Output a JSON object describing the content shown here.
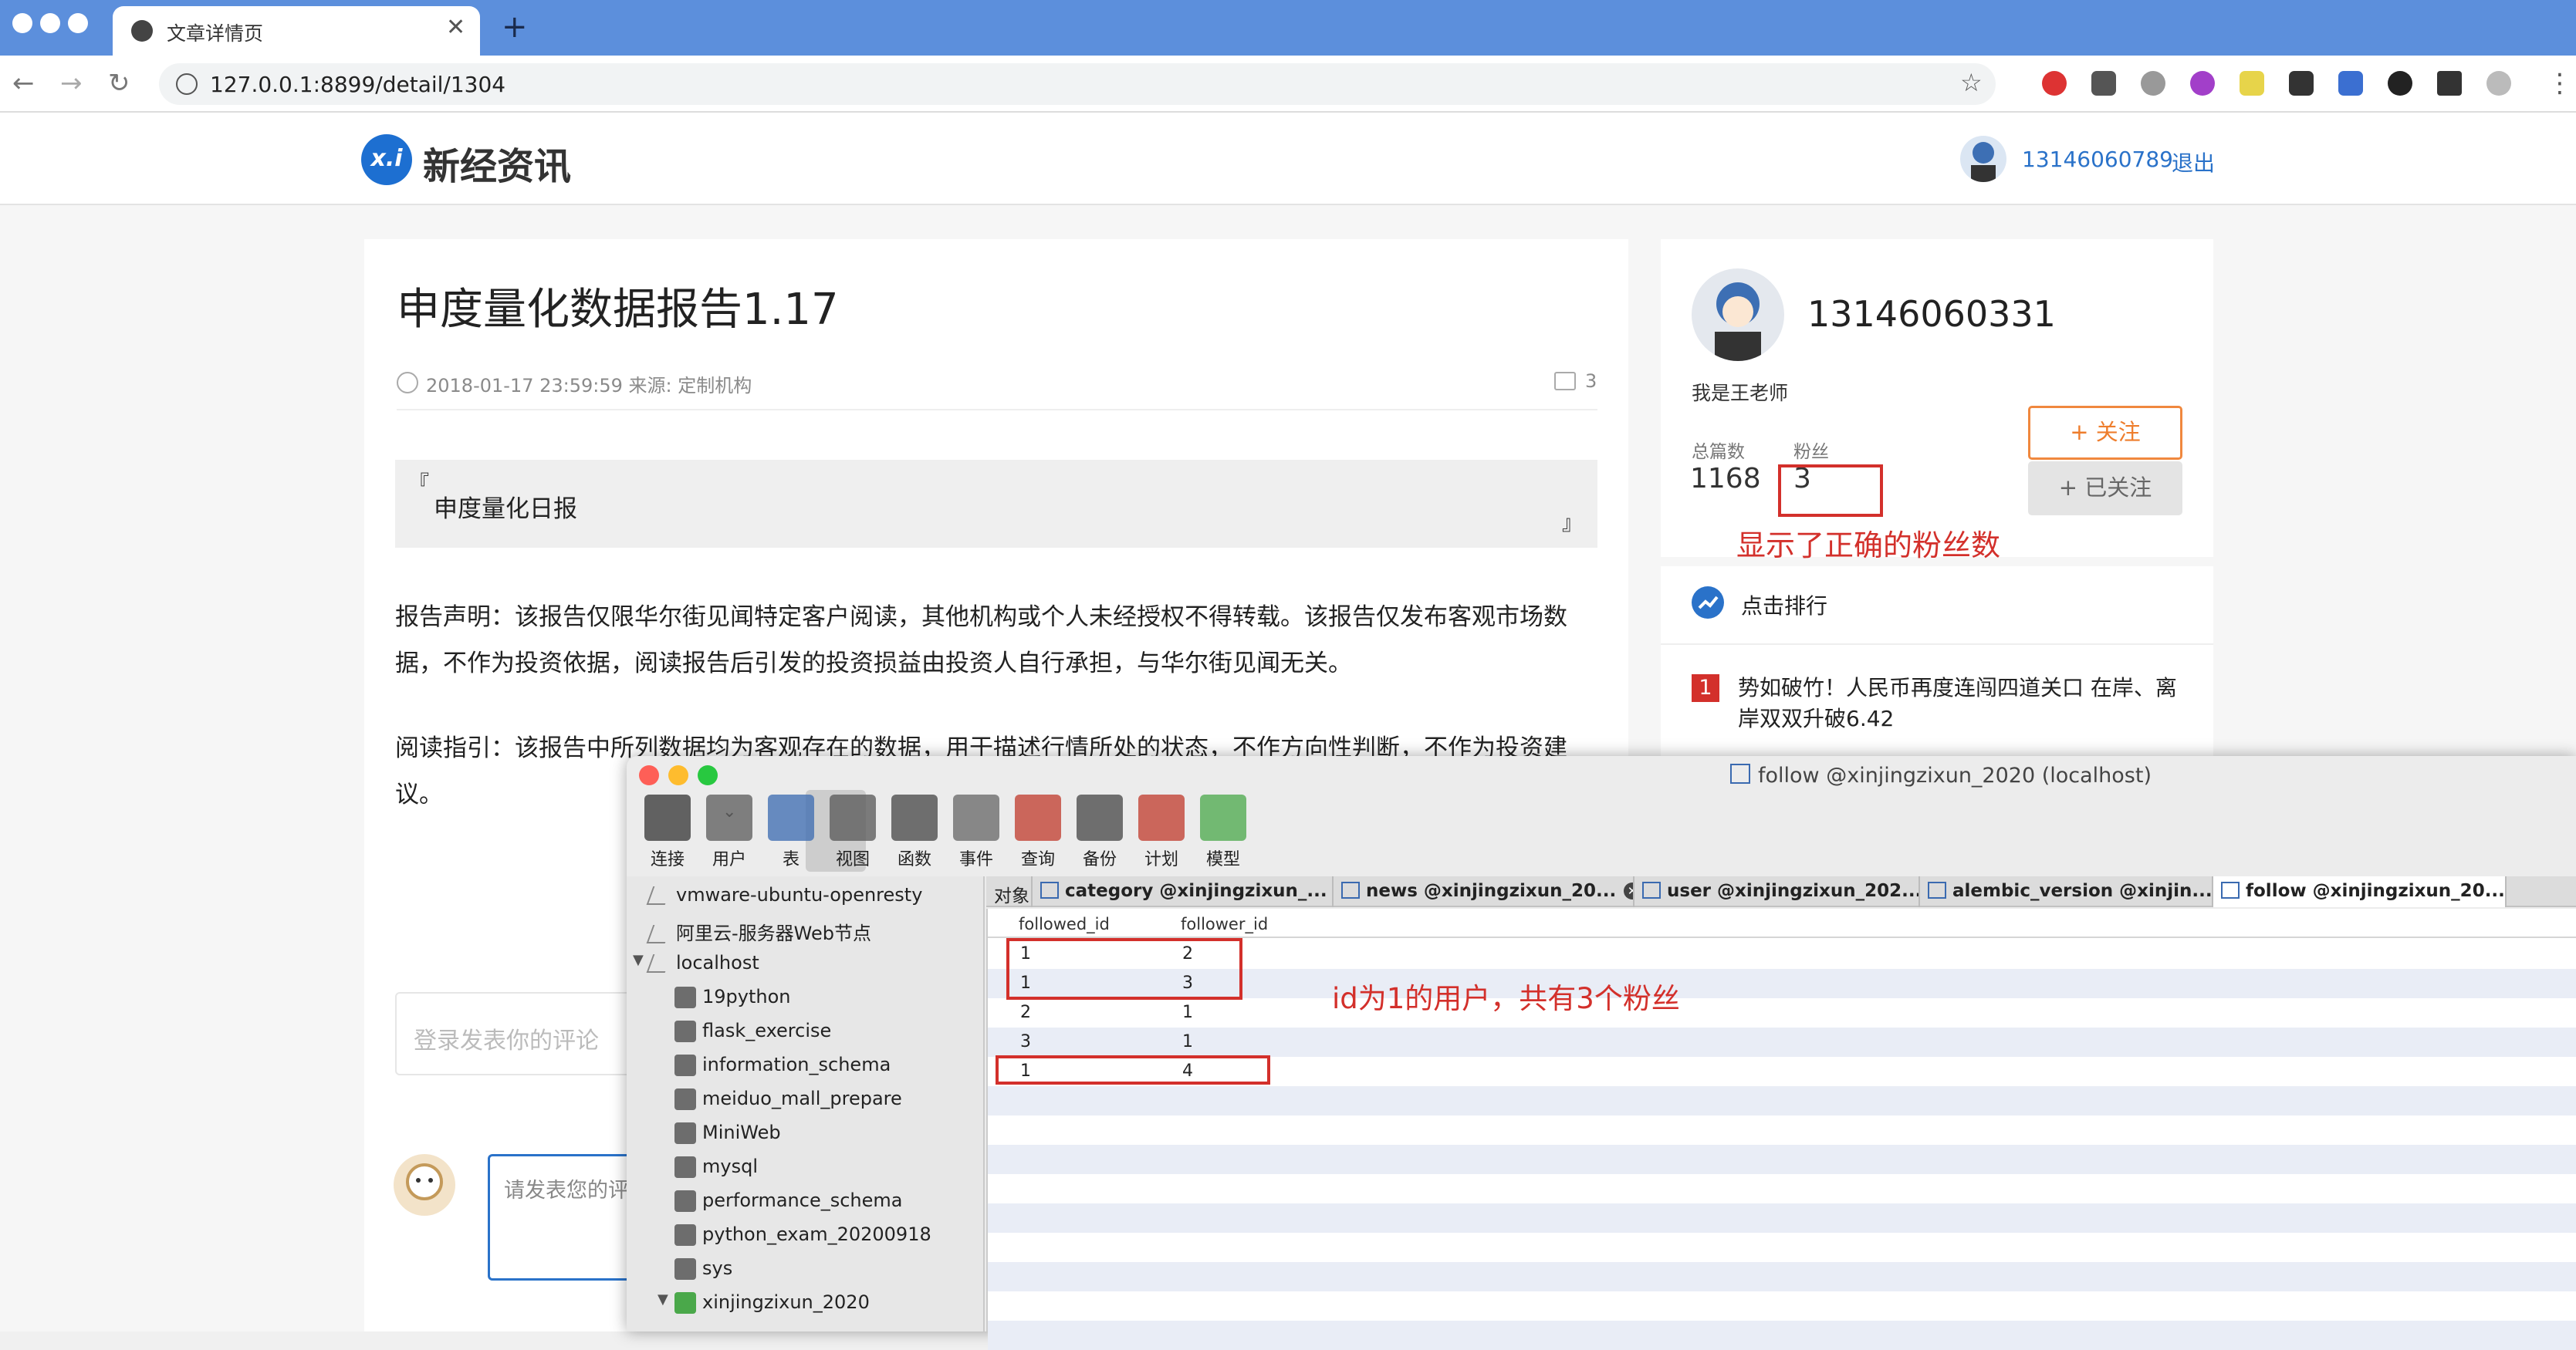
{
  "browser": {
    "tab_title": "文章详情页",
    "url": "127.0.0.1:8899/detail/1304",
    "new_tab": "+",
    "tab_close": "✕"
  },
  "site": {
    "logo_mark": "x.i",
    "logo_text": "新经资讯",
    "header_user": "13146060789",
    "logout": "退出"
  },
  "article": {
    "title": "申度量化数据报告1.17",
    "meta": "2018-01-17 23:59:59 来源: 定制机构",
    "comment_count": "3",
    "quote_open": "『",
    "quote_text": "申度量化日报",
    "quote_close": "』",
    "para1": "报告声明：该报告仅限华尔街见闻特定客户阅读，其他机构或个人未经授权不得转载。该报告仅发布客观市场数据，不作为投资依据，阅读报告后引发的投资损益由投资人自行承担，与华尔街见闻无关。",
    "para2": "阅读指引：该报告中所列数据均为客观存在的数据，用于描述行情所处的状态，不作方向性判断，不作为投资建议。",
    "comment_placeholder": "登录发表你的评论",
    "reply_placeholder": "请发表您的评论"
  },
  "author": {
    "name": "13146060331",
    "desc": "我是王老师",
    "posts_label": "总篇数",
    "fans_label": "粉丝",
    "posts": "1168",
    "fans": "3",
    "follow_btn": "+ 关注",
    "followed_btn": "+ 已关注",
    "annotation": "显示了正确的粉丝数"
  },
  "rank": {
    "title": "点击排行",
    "items": [
      {
        "num": "1",
        "text": "势如破竹！人民币再度连闯四道关口 在岸、离岸双双升破6.42"
      }
    ]
  },
  "navicat": {
    "title": "follow @xinjingzixun_2020 (localhost)",
    "toolbar": [
      "连接",
      "用户",
      "表",
      "视图",
      "函数",
      "事件",
      "查询",
      "备份",
      "计划",
      "模型"
    ],
    "toolbar_icons": [
      "connection-icon",
      "user-icon",
      "table-icon",
      "view-icon",
      "function-icon",
      "event-icon",
      "query-icon",
      "backup-icon",
      "schedule-icon",
      "model-icon"
    ],
    "tree": [
      {
        "label": "vmware-ubuntu-openresty",
        "kind": "conn"
      },
      {
        "label": "阿里云-服务器Web节点",
        "kind": "conn"
      },
      {
        "label": "localhost",
        "kind": "conn-open"
      },
      {
        "label": "19python",
        "kind": "db"
      },
      {
        "label": "flask_exercise",
        "kind": "db"
      },
      {
        "label": "information_schema",
        "kind": "db"
      },
      {
        "label": "meiduo_mall_prepare",
        "kind": "db"
      },
      {
        "label": "MiniWeb",
        "kind": "db"
      },
      {
        "label": "mysql",
        "kind": "db"
      },
      {
        "label": "performance_schema",
        "kind": "db"
      },
      {
        "label": "python_exam_20200918",
        "kind": "db"
      },
      {
        "label": "sys",
        "kind": "db"
      },
      {
        "label": "xinjingzixun_2020",
        "kind": "db-open"
      }
    ],
    "tabs": [
      "对象",
      "category @xinjingzixun_...",
      "news @xinjingzixun_20...",
      "user @xinjingzixun_202...",
      "alembic_version @xinjin...",
      "follow @xinjingzixun_20..."
    ],
    "columns": [
      "followed_id",
      "follower_id"
    ],
    "rows": [
      [
        "1",
        "2"
      ],
      [
        "1",
        "3"
      ],
      [
        "2",
        "1"
      ],
      [
        "3",
        "1"
      ],
      [
        "1",
        "4"
      ]
    ],
    "annotation": "id为1的用户，共有3个粉丝"
  },
  "colors": {
    "tabbar": "#5c8fdc",
    "link": "#2a72c9",
    "accent_orange": "#ee7d2c",
    "annotation_red": "#d3302b"
  }
}
